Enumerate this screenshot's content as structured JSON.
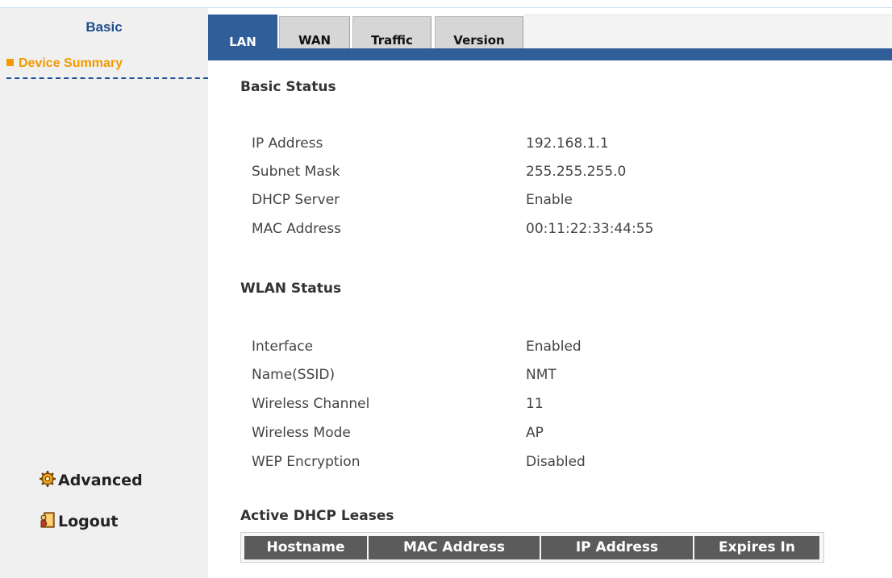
{
  "sidebar": {
    "heading": "Basic",
    "active_item": "Device Summary",
    "advanced_label": "Advanced",
    "logout_label": "Logout"
  },
  "tabs": [
    {
      "label": "LAN",
      "active": true
    },
    {
      "label": "WAN",
      "active": false
    },
    {
      "label": "Traffic",
      "active": false
    },
    {
      "label": "Version",
      "active": false
    }
  ],
  "basic_status": {
    "title": "Basic Status",
    "rows": [
      {
        "label": "IP Address",
        "value": "192.168.1.1"
      },
      {
        "label": "Subnet Mask",
        "value": "255.255.255.0"
      },
      {
        "label": "DHCP Server",
        "value": "Enable"
      },
      {
        "label": "MAC Address",
        "value": "00:11:22:33:44:55"
      }
    ]
  },
  "wlan_status": {
    "title": "WLAN Status",
    "rows": [
      {
        "label": "Interface",
        "value": "Enabled"
      },
      {
        "label": "Name(SSID)",
        "value": "NMT"
      },
      {
        "label": "Wireless Channel",
        "value": "11"
      },
      {
        "label": "Wireless Mode",
        "value": "AP"
      },
      {
        "label": "WEP Encryption",
        "value": "Disabled"
      }
    ]
  },
  "dhcp_leases": {
    "title": "Active DHCP Leases",
    "columns": [
      "Hostname",
      "MAC Address",
      "IP Address",
      "Expires In"
    ]
  },
  "colors": {
    "accent_blue": "#2f5e98",
    "active_orange": "#f29a00",
    "sidebar_bg": "#f0f0f0",
    "table_header": "#5b5b5b"
  },
  "icons": {
    "advanced": "gear-icon",
    "logout": "door-exit-icon"
  }
}
